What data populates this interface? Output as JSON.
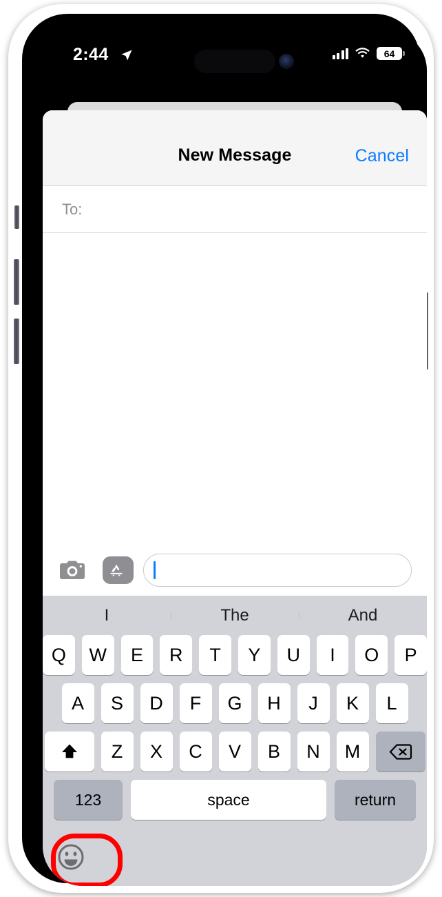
{
  "status_bar": {
    "time": "2:44",
    "location_icon": "location-arrow-icon",
    "cellular_icon": "signal-bars-icon",
    "wifi_icon": "wifi-icon",
    "battery_level": "64"
  },
  "navbar": {
    "title": "New Message",
    "cancel_label": "Cancel",
    "accent_color": "#0a7cff"
  },
  "compose": {
    "to_label": "To:",
    "to_value": "",
    "message_placeholder": "",
    "message_value": "",
    "camera_icon": "camera-icon",
    "apps_icon": "app-store-icon"
  },
  "keyboard": {
    "predictive": [
      "I",
      "The",
      "And"
    ],
    "row1": [
      "Q",
      "W",
      "E",
      "R",
      "T",
      "Y",
      "U",
      "I",
      "O",
      "P"
    ],
    "row2": [
      "A",
      "S",
      "D",
      "F",
      "G",
      "H",
      "J",
      "K",
      "L"
    ],
    "row3": [
      "Z",
      "X",
      "C",
      "V",
      "B",
      "N",
      "M"
    ],
    "shift_icon": "shift-arrow-icon",
    "backspace_icon": "backspace-delete-icon",
    "numbers_label": "123",
    "space_label": "space",
    "return_label": "return",
    "emoji_icon": "smiley-face-icon"
  },
  "annotation": {
    "target": "emoji-keyboard-button",
    "shape": "rounded-rectangle-outline",
    "color": "#fe0000"
  }
}
